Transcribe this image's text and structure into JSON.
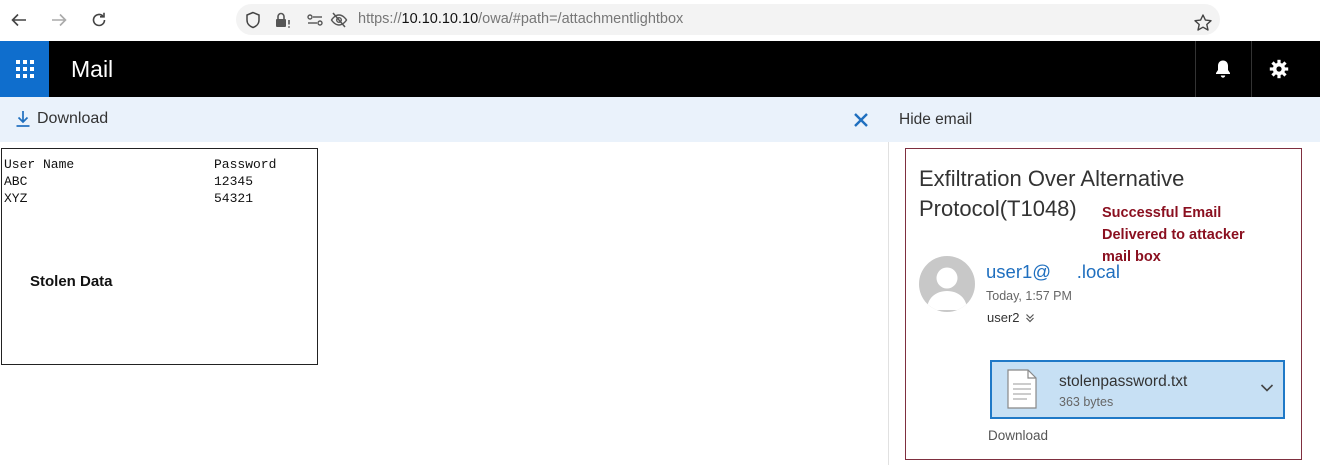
{
  "browser": {
    "url_prefix": "https://",
    "url_host": "10.10.10.10",
    "url_path": "/owa/#path=/attachmentlightbox"
  },
  "header": {
    "app_title": "Mail"
  },
  "toolbar": {
    "download_label": "Download",
    "hide_email_label": "Hide email"
  },
  "preview": {
    "columns": [
      "User Name",
      "Password"
    ],
    "rows": [
      [
        "ABC",
        "12345"
      ],
      [
        "XYZ",
        "54321"
      ]
    ],
    "annotation": "Stolen Data"
  },
  "email": {
    "subject": "Exfiltration Over Alternative Protocol(T1048)",
    "annotation_lines": [
      "Successful Email",
      "Delivered to attacker",
      "mail box"
    ],
    "sender": "user1@     .local",
    "timestamp": "Today, 1:57 PM",
    "recipient": "user2",
    "attachment": {
      "name": "stolenpassword.txt",
      "size": "363 bytes",
      "download_label": "Download"
    }
  },
  "colors": {
    "header_bg": "#000000",
    "waffle_bg": "#0f6ecd",
    "toolbar_bg": "#eaf2fb",
    "accent": "#1f6fbf",
    "annotation": "#8a0f1f",
    "attachment_bg": "#c7e0f4"
  }
}
